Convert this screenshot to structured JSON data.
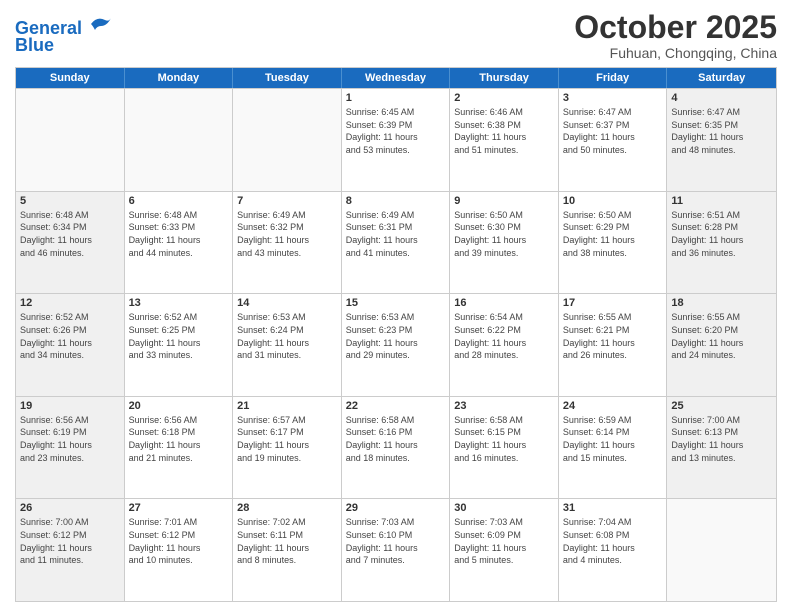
{
  "header": {
    "logo_line1": "General",
    "logo_line2": "Blue",
    "title": "October 2025",
    "subtitle": "Fuhuan, Chongqing, China"
  },
  "weekdays": [
    "Sunday",
    "Monday",
    "Tuesday",
    "Wednesday",
    "Thursday",
    "Friday",
    "Saturday"
  ],
  "weeks": [
    [
      {
        "day": "",
        "info": "",
        "empty": true
      },
      {
        "day": "",
        "info": "",
        "empty": true
      },
      {
        "day": "",
        "info": "",
        "empty": true
      },
      {
        "day": "1",
        "info": "Sunrise: 6:45 AM\nSunset: 6:39 PM\nDaylight: 11 hours\nand 53 minutes.",
        "empty": false
      },
      {
        "day": "2",
        "info": "Sunrise: 6:46 AM\nSunset: 6:38 PM\nDaylight: 11 hours\nand 51 minutes.",
        "empty": false
      },
      {
        "day": "3",
        "info": "Sunrise: 6:47 AM\nSunset: 6:37 PM\nDaylight: 11 hours\nand 50 minutes.",
        "empty": false
      },
      {
        "day": "4",
        "info": "Sunrise: 6:47 AM\nSunset: 6:35 PM\nDaylight: 11 hours\nand 48 minutes.",
        "empty": false,
        "shaded": true
      }
    ],
    [
      {
        "day": "5",
        "info": "Sunrise: 6:48 AM\nSunset: 6:34 PM\nDaylight: 11 hours\nand 46 minutes.",
        "empty": false,
        "shaded": true
      },
      {
        "day": "6",
        "info": "Sunrise: 6:48 AM\nSunset: 6:33 PM\nDaylight: 11 hours\nand 44 minutes.",
        "empty": false
      },
      {
        "day": "7",
        "info": "Sunrise: 6:49 AM\nSunset: 6:32 PM\nDaylight: 11 hours\nand 43 minutes.",
        "empty": false
      },
      {
        "day": "8",
        "info": "Sunrise: 6:49 AM\nSunset: 6:31 PM\nDaylight: 11 hours\nand 41 minutes.",
        "empty": false
      },
      {
        "day": "9",
        "info": "Sunrise: 6:50 AM\nSunset: 6:30 PM\nDaylight: 11 hours\nand 39 minutes.",
        "empty": false
      },
      {
        "day": "10",
        "info": "Sunrise: 6:50 AM\nSunset: 6:29 PM\nDaylight: 11 hours\nand 38 minutes.",
        "empty": false
      },
      {
        "day": "11",
        "info": "Sunrise: 6:51 AM\nSunset: 6:28 PM\nDaylight: 11 hours\nand 36 minutes.",
        "empty": false,
        "shaded": true
      }
    ],
    [
      {
        "day": "12",
        "info": "Sunrise: 6:52 AM\nSunset: 6:26 PM\nDaylight: 11 hours\nand 34 minutes.",
        "empty": false,
        "shaded": true
      },
      {
        "day": "13",
        "info": "Sunrise: 6:52 AM\nSunset: 6:25 PM\nDaylight: 11 hours\nand 33 minutes.",
        "empty": false
      },
      {
        "day": "14",
        "info": "Sunrise: 6:53 AM\nSunset: 6:24 PM\nDaylight: 11 hours\nand 31 minutes.",
        "empty": false
      },
      {
        "day": "15",
        "info": "Sunrise: 6:53 AM\nSunset: 6:23 PM\nDaylight: 11 hours\nand 29 minutes.",
        "empty": false
      },
      {
        "day": "16",
        "info": "Sunrise: 6:54 AM\nSunset: 6:22 PM\nDaylight: 11 hours\nand 28 minutes.",
        "empty": false
      },
      {
        "day": "17",
        "info": "Sunrise: 6:55 AM\nSunset: 6:21 PM\nDaylight: 11 hours\nand 26 minutes.",
        "empty": false
      },
      {
        "day": "18",
        "info": "Sunrise: 6:55 AM\nSunset: 6:20 PM\nDaylight: 11 hours\nand 24 minutes.",
        "empty": false,
        "shaded": true
      }
    ],
    [
      {
        "day": "19",
        "info": "Sunrise: 6:56 AM\nSunset: 6:19 PM\nDaylight: 11 hours\nand 23 minutes.",
        "empty": false,
        "shaded": true
      },
      {
        "day": "20",
        "info": "Sunrise: 6:56 AM\nSunset: 6:18 PM\nDaylight: 11 hours\nand 21 minutes.",
        "empty": false
      },
      {
        "day": "21",
        "info": "Sunrise: 6:57 AM\nSunset: 6:17 PM\nDaylight: 11 hours\nand 19 minutes.",
        "empty": false
      },
      {
        "day": "22",
        "info": "Sunrise: 6:58 AM\nSunset: 6:16 PM\nDaylight: 11 hours\nand 18 minutes.",
        "empty": false
      },
      {
        "day": "23",
        "info": "Sunrise: 6:58 AM\nSunset: 6:15 PM\nDaylight: 11 hours\nand 16 minutes.",
        "empty": false
      },
      {
        "day": "24",
        "info": "Sunrise: 6:59 AM\nSunset: 6:14 PM\nDaylight: 11 hours\nand 15 minutes.",
        "empty": false
      },
      {
        "day": "25",
        "info": "Sunrise: 7:00 AM\nSunset: 6:13 PM\nDaylight: 11 hours\nand 13 minutes.",
        "empty": false,
        "shaded": true
      }
    ],
    [
      {
        "day": "26",
        "info": "Sunrise: 7:00 AM\nSunset: 6:12 PM\nDaylight: 11 hours\nand 11 minutes.",
        "empty": false,
        "shaded": true
      },
      {
        "day": "27",
        "info": "Sunrise: 7:01 AM\nSunset: 6:12 PM\nDaylight: 11 hours\nand 10 minutes.",
        "empty": false
      },
      {
        "day": "28",
        "info": "Sunrise: 7:02 AM\nSunset: 6:11 PM\nDaylight: 11 hours\nand 8 minutes.",
        "empty": false
      },
      {
        "day": "29",
        "info": "Sunrise: 7:03 AM\nSunset: 6:10 PM\nDaylight: 11 hours\nand 7 minutes.",
        "empty": false
      },
      {
        "day": "30",
        "info": "Sunrise: 7:03 AM\nSunset: 6:09 PM\nDaylight: 11 hours\nand 5 minutes.",
        "empty": false
      },
      {
        "day": "31",
        "info": "Sunrise: 7:04 AM\nSunset: 6:08 PM\nDaylight: 11 hours\nand 4 minutes.",
        "empty": false
      },
      {
        "day": "",
        "info": "",
        "empty": true
      }
    ]
  ]
}
